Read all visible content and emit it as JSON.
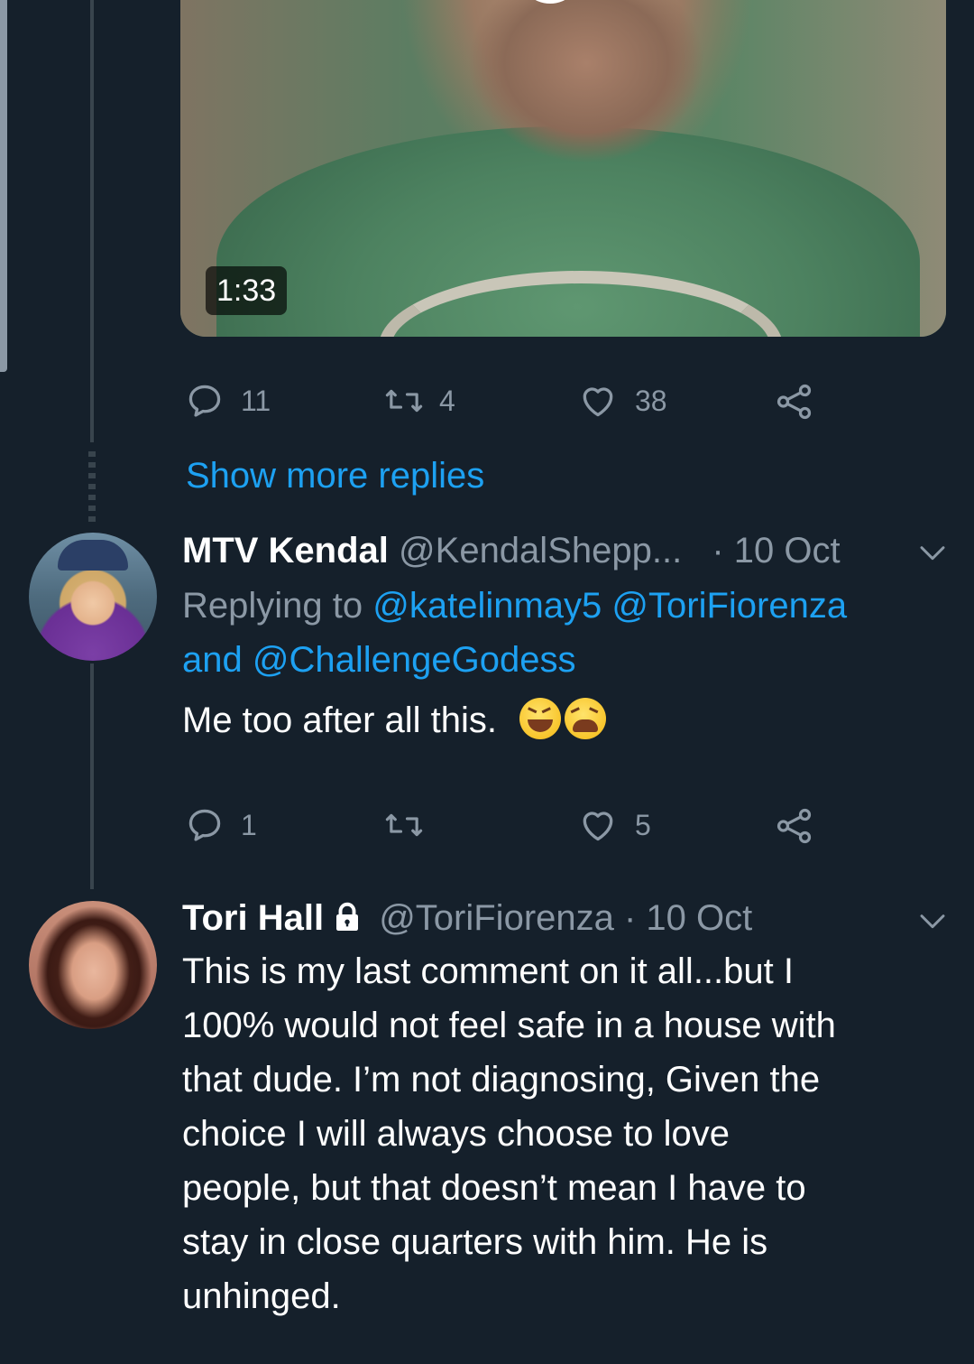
{
  "video": {
    "duration": "1:33"
  },
  "first_tweet_actions": {
    "replies": "11",
    "retweets": "4",
    "likes": "38"
  },
  "show_more_replies": "Show more replies",
  "kendal_tweet": {
    "name": "MTV Kendal",
    "handle": "@KendalShepp...",
    "date": "· 10 Oct",
    "replying_to_prefix": "Replying to",
    "mention_1": "@katelinmay5",
    "mention_2": "@ToriFiorenza",
    "and_text": "and",
    "mention_3": "@ChallengeGodess",
    "text": "Me too after all this.",
    "emojis": [
      "grinning-squinting-face",
      "tired-face"
    ],
    "actions": {
      "replies": "1",
      "retweets": "",
      "likes": "5"
    }
  },
  "tori_tweet": {
    "name": "Tori Hall",
    "handle": "@ToriFiorenza",
    "date": "· 10 Oct",
    "text_lines": [
      "This is my last comment on it all...but I",
      "100% would not feel safe in a house with",
      "that dude. I’m not diagnosing, Given the",
      "choice I will always choose to love",
      "people, but that doesn’t mean I have to",
      "stay in close quarters with him. He is",
      "unhinged."
    ]
  },
  "colors": {
    "background": "#15202b",
    "accent": "#1da1f2",
    "muted": "#8b98a5",
    "text": "#ffffff"
  }
}
